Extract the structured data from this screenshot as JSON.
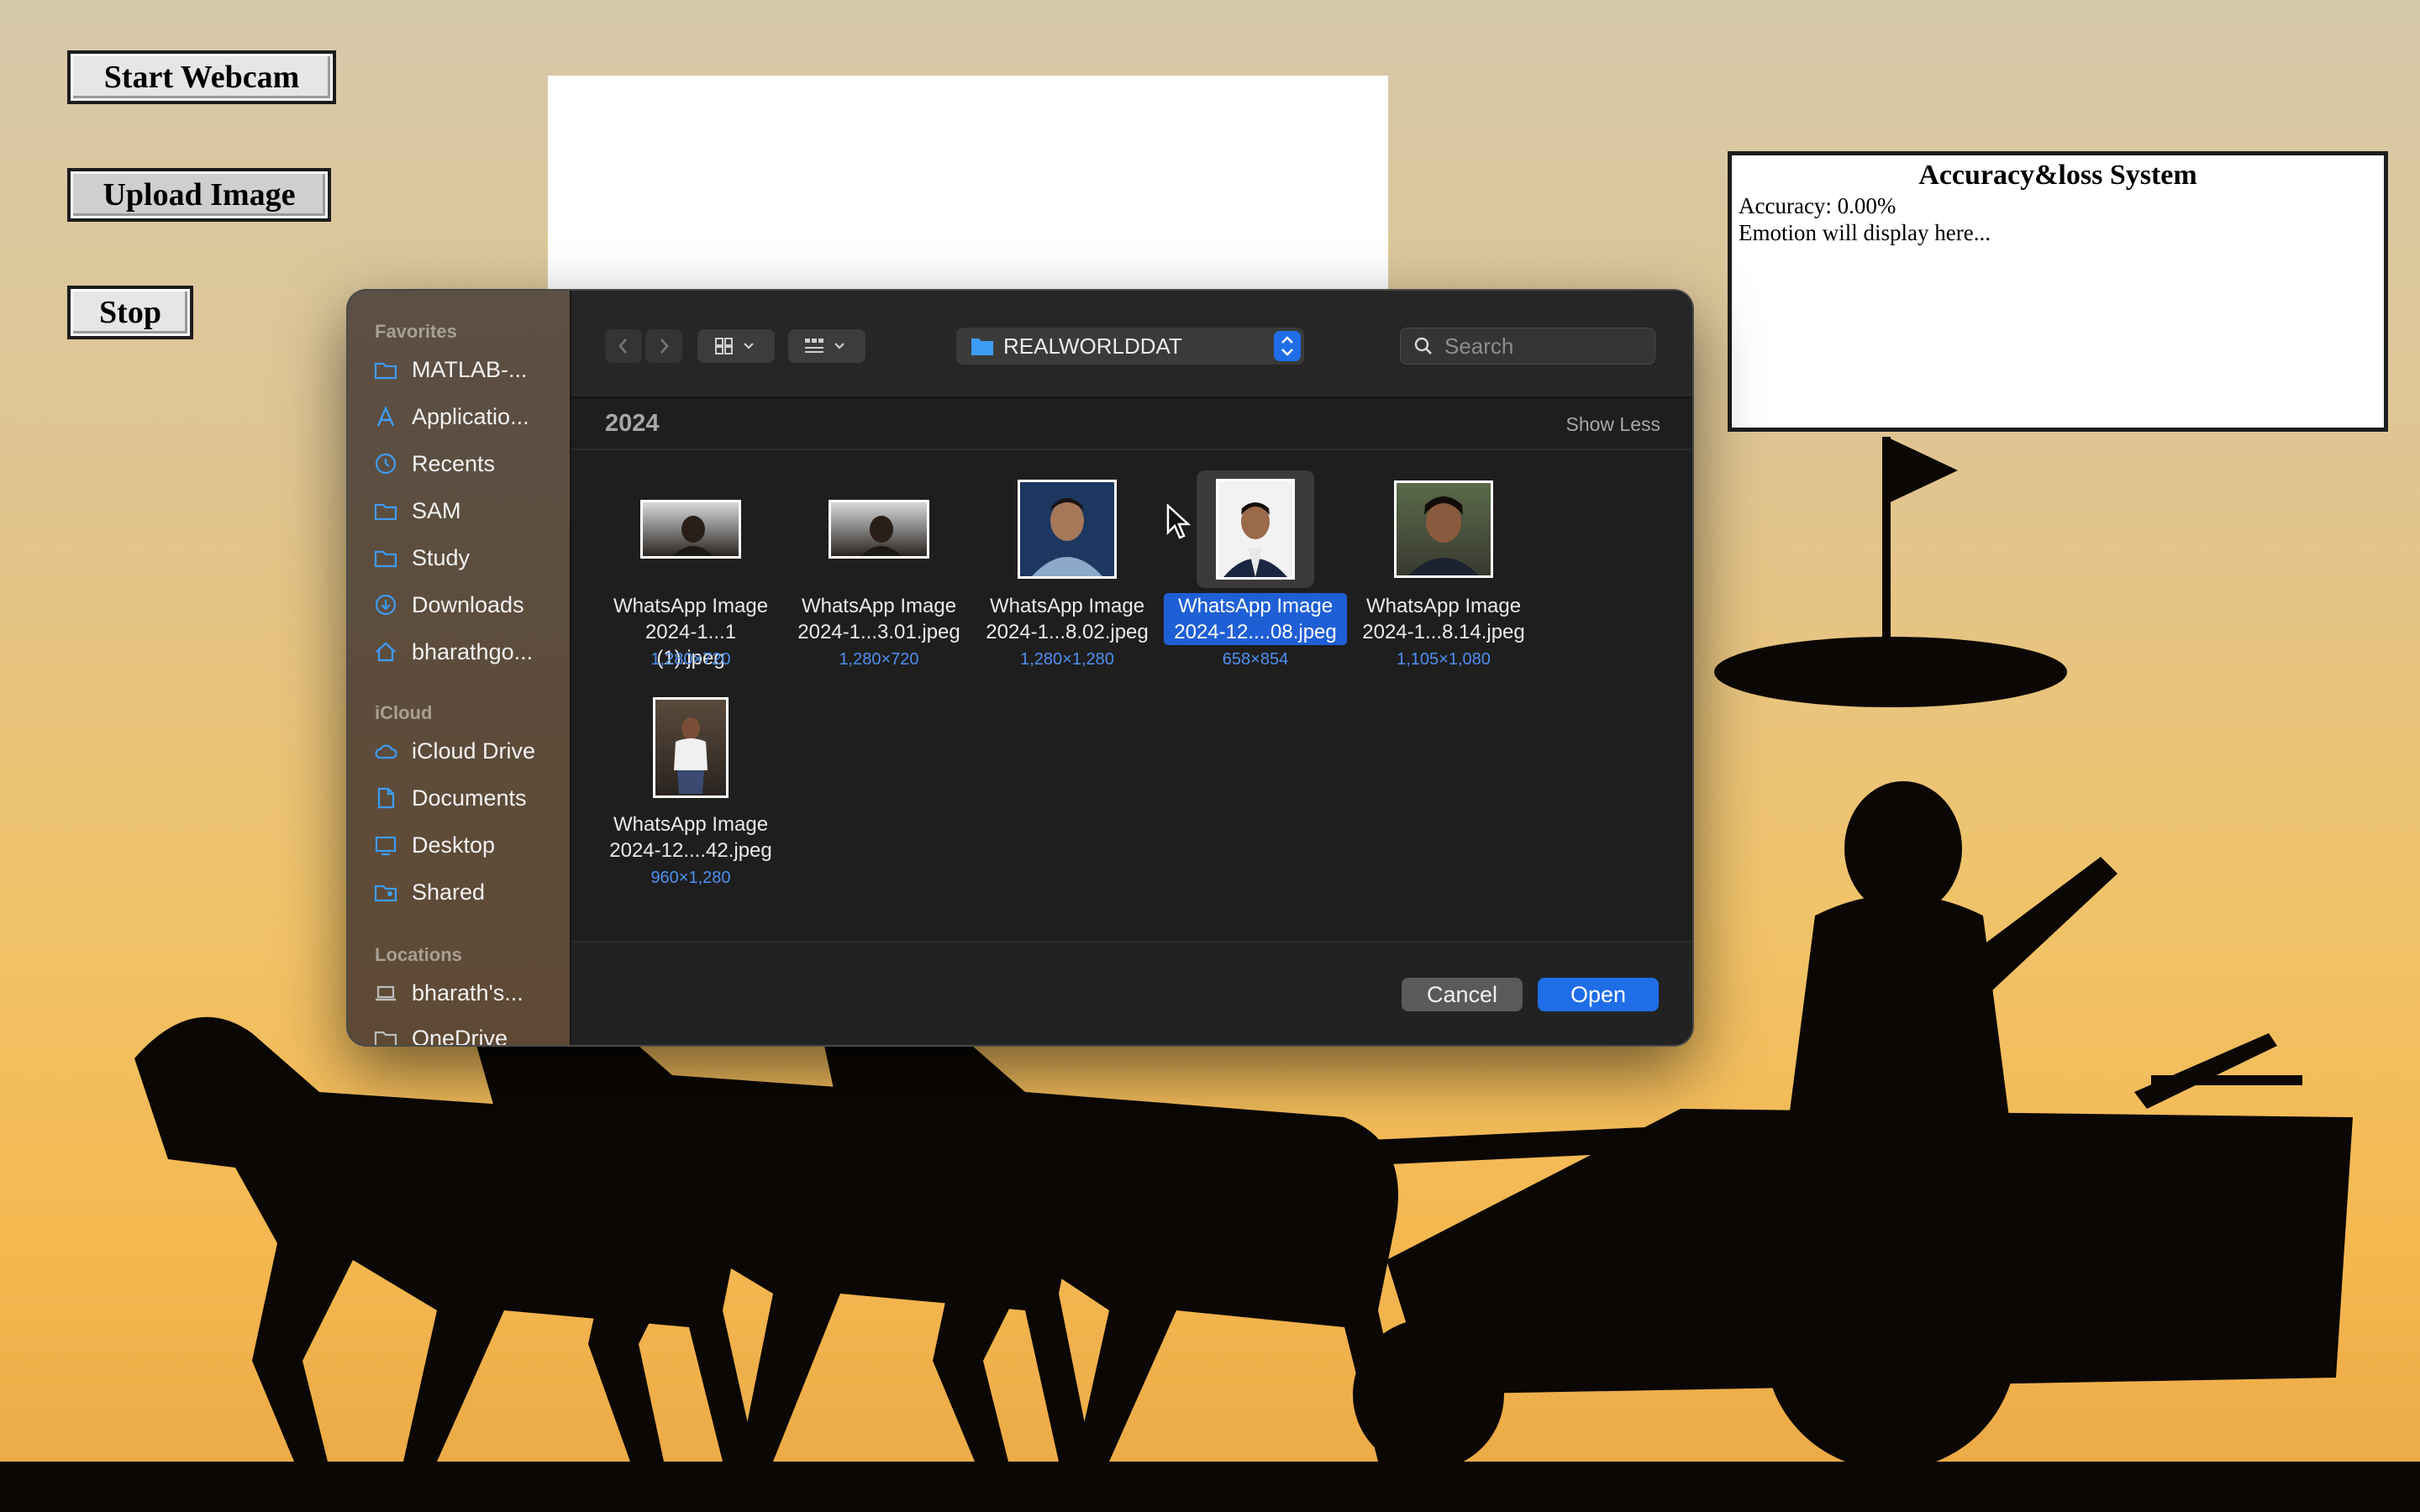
{
  "page": {
    "buttons": {
      "start_webcam": "Start Webcam",
      "upload_image": "Upload Image",
      "stop": "Stop"
    },
    "accuracy_panel": {
      "title": "Accuracy&loss System",
      "accuracy": "Accuracy: 0.00%",
      "emotion": "Emotion will display here..."
    }
  },
  "dialog": {
    "sidebar": {
      "favorites_header": "Favorites",
      "favorites": [
        {
          "label": "MATLAB-...",
          "icon": "folder-icon"
        },
        {
          "label": "Applicatio...",
          "icon": "applications-icon"
        },
        {
          "label": "Recents",
          "icon": "clock-icon"
        },
        {
          "label": "SAM",
          "icon": "folder-icon"
        },
        {
          "label": "Study",
          "icon": "folder-icon"
        },
        {
          "label": "Downloads",
          "icon": "download-icon"
        },
        {
          "label": "bharathgo...",
          "icon": "home-icon"
        }
      ],
      "icloud_header": "iCloud",
      "icloud": [
        {
          "label": "iCloud Drive",
          "icon": "cloud-icon"
        },
        {
          "label": "Documents",
          "icon": "document-icon"
        },
        {
          "label": "Desktop",
          "icon": "desktop-icon"
        },
        {
          "label": "Shared",
          "icon": "shared-folder-icon"
        }
      ],
      "locations_header": "Locations",
      "locations": [
        {
          "label": "bharath's...",
          "icon": "laptop-icon"
        },
        {
          "label": "OneDrive",
          "icon": "folder-icon"
        }
      ]
    },
    "toolbar": {
      "folder_name": "REALWORLDDAT",
      "search_placeholder": "Search"
    },
    "section": {
      "title": "2024",
      "toggle": "Show Less"
    },
    "files": [
      {
        "line1": "WhatsApp Image",
        "line2": "2024-1...1 (1).jpeg",
        "dims": "1,280×720",
        "selected": false
      },
      {
        "line1": "WhatsApp Image",
        "line2": "2024-1...3.01.jpeg",
        "dims": "1,280×720",
        "selected": false
      },
      {
        "line1": "WhatsApp Image",
        "line2": "2024-1...8.02.jpeg",
        "dims": "1,280×1,280",
        "selected": false
      },
      {
        "line1": "WhatsApp Image",
        "line2": "2024-12....08.jpeg",
        "dims": "658×854",
        "selected": true
      },
      {
        "line1": "WhatsApp Image",
        "line2": "2024-1...8.14.jpeg",
        "dims": "1,105×1,080",
        "selected": false
      },
      {
        "line1": "WhatsApp Image",
        "line2": "2024-12....42.jpeg",
        "dims": "960×1,280",
        "selected": false
      }
    ],
    "footer": {
      "cancel": "Cancel",
      "open": "Open"
    }
  },
  "colors": {
    "accent": "#1f6ee8",
    "silhouette": "#0b0704",
    "sky_top": "#d6c9aa",
    "sky_bottom": "#f5b850"
  }
}
